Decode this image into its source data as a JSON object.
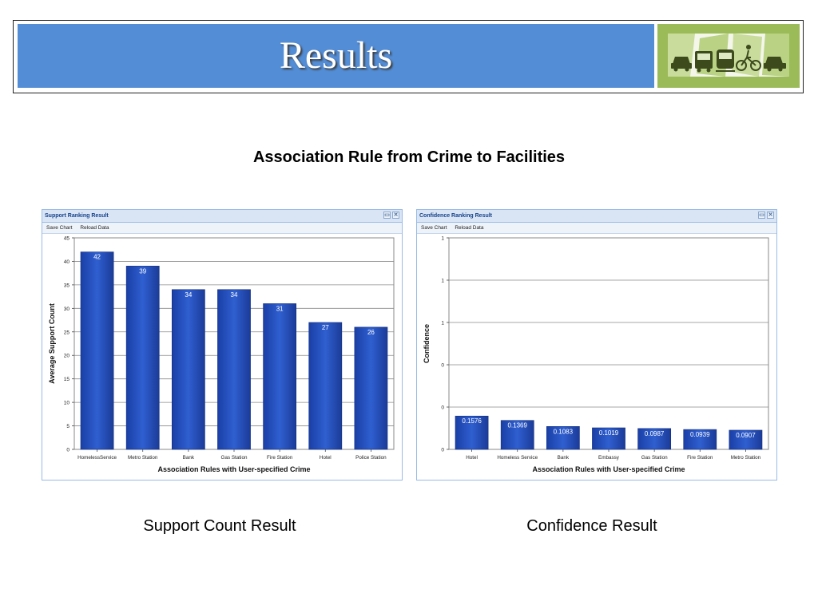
{
  "header": {
    "title": "Results"
  },
  "slide": {
    "subtitle": "Association Rule from Crime to Facilities",
    "captions": [
      "Support Count Result",
      "Confidence Result"
    ]
  },
  "panels": [
    {
      "title": "Support Ranking Result",
      "toolbar": [
        "Save Chart",
        "Reload Data"
      ]
    },
    {
      "title": "Confidence Ranking Result",
      "toolbar": [
        "Save Chart",
        "Reload Data"
      ]
    }
  ],
  "colors": {
    "bar": "#2f5fd0",
    "header": "#538dd5",
    "logo": "#9bbb59"
  },
  "icons": [
    "restore-icon",
    "close-icon",
    "car-icon",
    "bus-icon",
    "train-icon",
    "bicycle-icon"
  ],
  "chart_data": [
    {
      "type": "bar",
      "categories": [
        "HomelessService",
        "Metro Station",
        "Bank",
        "Gas Station",
        "Fire Station",
        "Hotel",
        "Police Station"
      ],
      "values": [
        42,
        39,
        34,
        34,
        31,
        27,
        26
      ],
      "labels": [
        "42",
        "39",
        "34",
        "34",
        "31",
        "27",
        "26"
      ],
      "xlabel": "Association Rules with User-specified Crime",
      "ylabel": "Average Support Count",
      "ylim": [
        0,
        45
      ],
      "yticks": [
        0,
        5,
        10,
        15,
        20,
        25,
        30,
        35,
        40,
        45
      ],
      "ytick_labels": [
        "0",
        "5",
        "10",
        "15",
        "20",
        "25",
        "30",
        "35",
        "40",
        "45"
      ],
      "grid": true
    },
    {
      "type": "bar",
      "categories": [
        "Hotel",
        "Homeless Service",
        "Bank",
        "Embassy",
        "Gas Station",
        "Fire Station",
        "Metro Station"
      ],
      "values": [
        0.1576,
        0.1369,
        0.1083,
        0.1019,
        0.0987,
        0.0939,
        0.0907
      ],
      "labels": [
        "0.1576",
        "0.1369",
        "0.1083",
        "0.1019",
        "0.0987",
        "0.0939",
        "0.0907"
      ],
      "xlabel": "Association Rules with User-specified Crime",
      "ylabel": "Confidence",
      "ylim": [
        0,
        1
      ],
      "yticks": [
        0,
        0.2,
        0.4,
        0.6,
        0.8,
        1.0
      ],
      "ytick_labels": [
        "0",
        "0",
        "0",
        "1",
        "1",
        "1"
      ],
      "grid": true
    }
  ]
}
